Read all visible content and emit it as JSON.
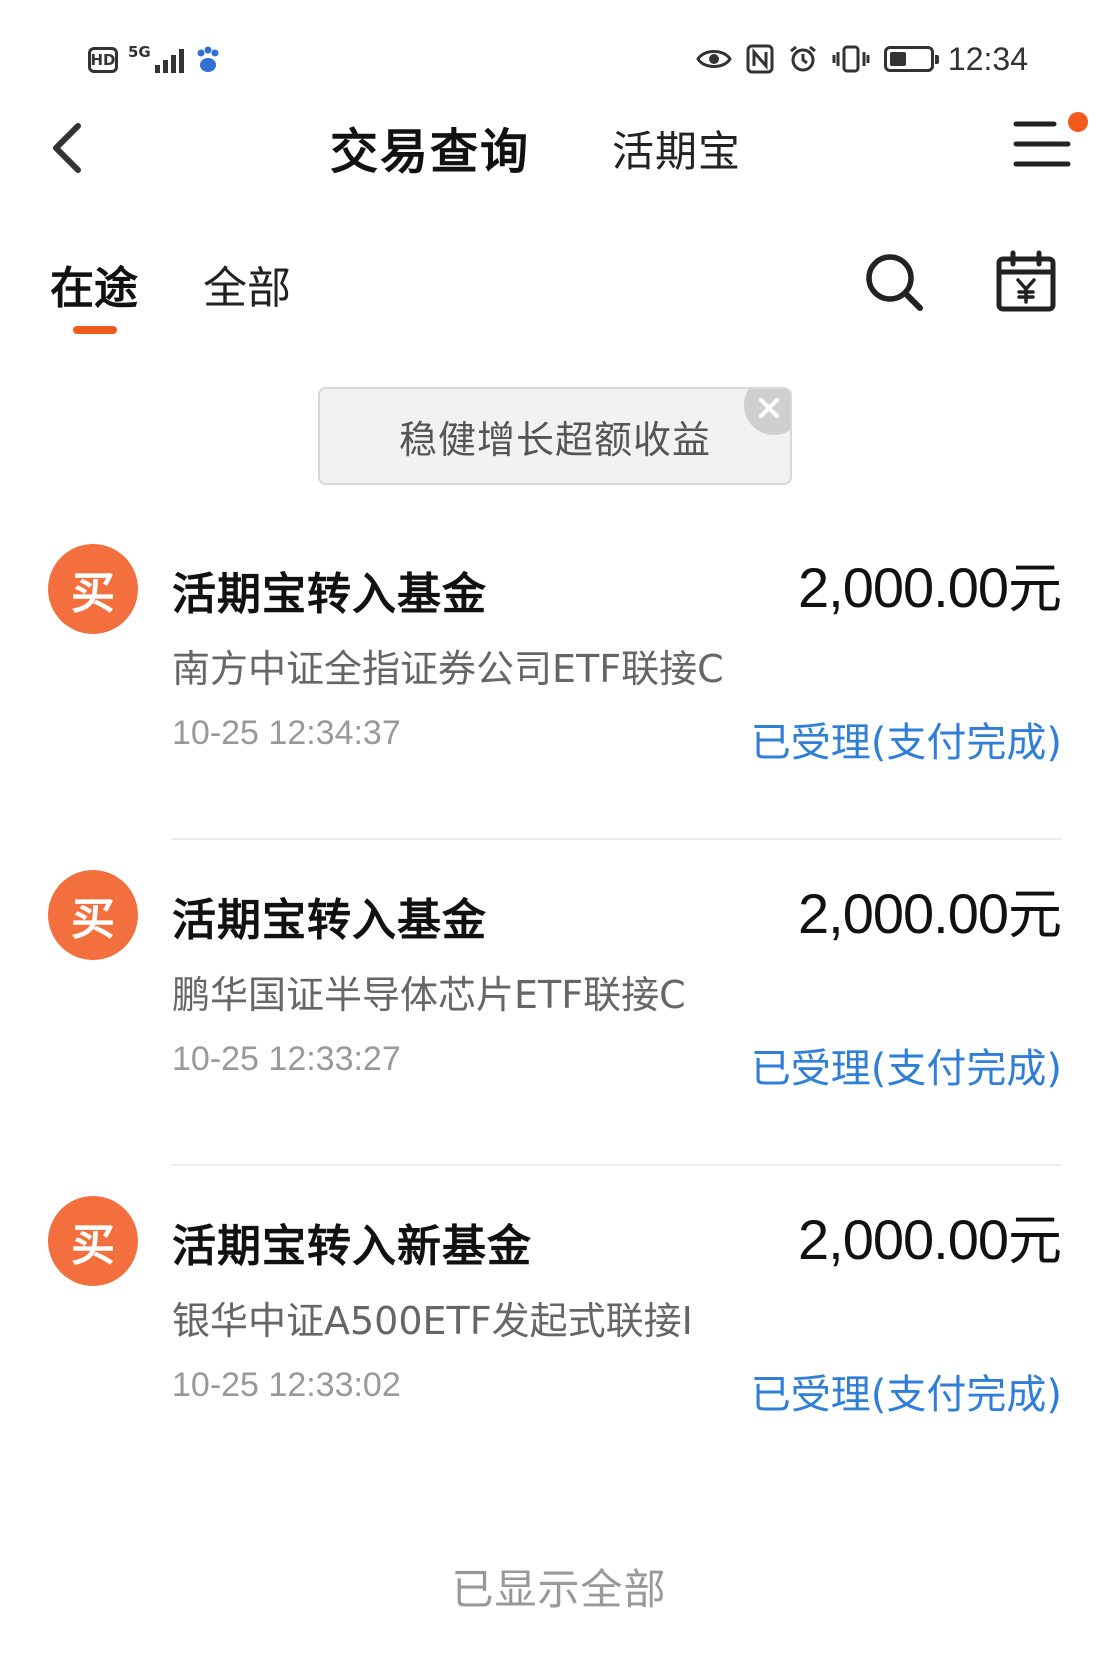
{
  "status_bar": {
    "hd_label": "HD",
    "network_label": "5G",
    "time": "12:34"
  },
  "header": {
    "title": "交易查询",
    "subtitle": "活期宝"
  },
  "tabs": [
    {
      "label": "在途",
      "active": true
    },
    {
      "label": "全部",
      "active": false
    }
  ],
  "promo": {
    "text": "稳健增长超额收益"
  },
  "transactions": [
    {
      "icon_text": "买",
      "title": "活期宝转入基金",
      "amount": "2,000.00",
      "currency_unit": "元",
      "fund_name": "南方中证全指证券公司ETF联接C",
      "time": "10-25 12:34:37",
      "status": "已受理(支付完成)"
    },
    {
      "icon_text": "买",
      "title": "活期宝转入基金",
      "amount": "2,000.00",
      "currency_unit": "元",
      "fund_name": "鹏华国证半导体芯片ETF联接C",
      "time": "10-25 12:33:27",
      "status": "已受理(支付完成)"
    },
    {
      "icon_text": "买",
      "title": "活期宝转入新基金",
      "amount": "2,000.00",
      "currency_unit": "元",
      "fund_name": "银华中证A500ETF发起式联接I",
      "time": "10-25 12:33:02",
      "status": "已受理(支付完成)"
    }
  ],
  "footer": {
    "text": "已显示全部"
  },
  "colors": {
    "accent": "#f25a1e",
    "buy_icon": "#f3703e",
    "status_blue": "#2f7ed8"
  },
  "icons": {
    "back": "chevron-left-icon",
    "menu": "menu-icon",
    "search": "search-icon",
    "calendar": "calendar-yuan-icon",
    "close": "close-icon"
  }
}
